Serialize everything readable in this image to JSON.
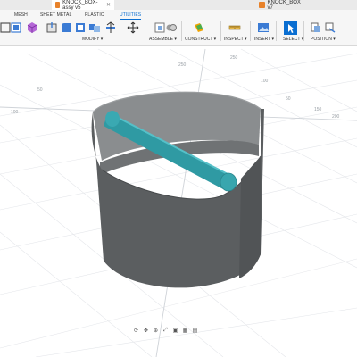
{
  "tabs": [
    {
      "label": "KNOCK_BOX-assy v5",
      "active": true
    },
    {
      "label": "KNOCK_BOX v7",
      "active": false
    }
  ],
  "workspace_tabs": [
    "MESH",
    "SHEET METAL",
    "PLASTIC",
    "UTILITIES"
  ],
  "toolbar_groups": {
    "modify": "MODIFY ▾",
    "assemble": "ASSEMBLE ▾",
    "construct": "CONSTRUCT ▾",
    "inspect": "INSPECT ▾",
    "insert": "INSERT ▾",
    "select": "SELECT ▾",
    "position": "POSITION ▾"
  },
  "viewport": {
    "axis_labels": [
      "250",
      "250",
      "50",
      "100",
      "100",
      "50",
      "150",
      "200"
    ]
  },
  "colors": {
    "accent": "#0a6ed1",
    "body": "#5b5e60",
    "bar": "#2f9aa3",
    "grid": "#e4e6ea"
  },
  "navbar_icons": [
    "orbit-icon",
    "pan-icon",
    "zoom-icon",
    "fit-icon",
    "display-icon",
    "grid-icon",
    "viewports-icon"
  ]
}
